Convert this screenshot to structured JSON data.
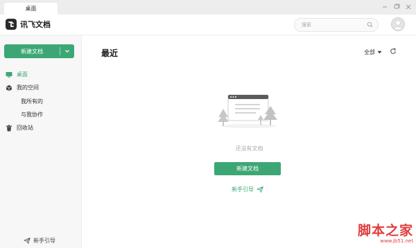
{
  "window": {
    "tab_label": "桌面"
  },
  "header": {
    "app_name": "讯飞文档",
    "search_placeholder": "搜索"
  },
  "sidebar": {
    "new_button_label": "新建文档",
    "items": [
      {
        "label": "桌面",
        "icon": "desktop-icon",
        "active": true
      },
      {
        "label": "我的空间",
        "icon": "cube-icon",
        "active": false
      },
      {
        "label": "回收站",
        "icon": "trash-icon",
        "active": false
      }
    ],
    "subitems": [
      {
        "label": "我所有的"
      },
      {
        "label": "与我协作"
      }
    ],
    "guide_label": "新手引导"
  },
  "main": {
    "title": "最近",
    "filter_label": "全部",
    "empty_text": "还没有文档",
    "new_doc_label": "新建文档",
    "guide_label": "新手引导"
  },
  "watermark": {
    "text": "脚本之家",
    "url": "www.jb51.net"
  },
  "colors": {
    "accent": "#3ca775",
    "sidebar_bg": "#f7f7f7",
    "titlebar_bg": "#ededed"
  }
}
